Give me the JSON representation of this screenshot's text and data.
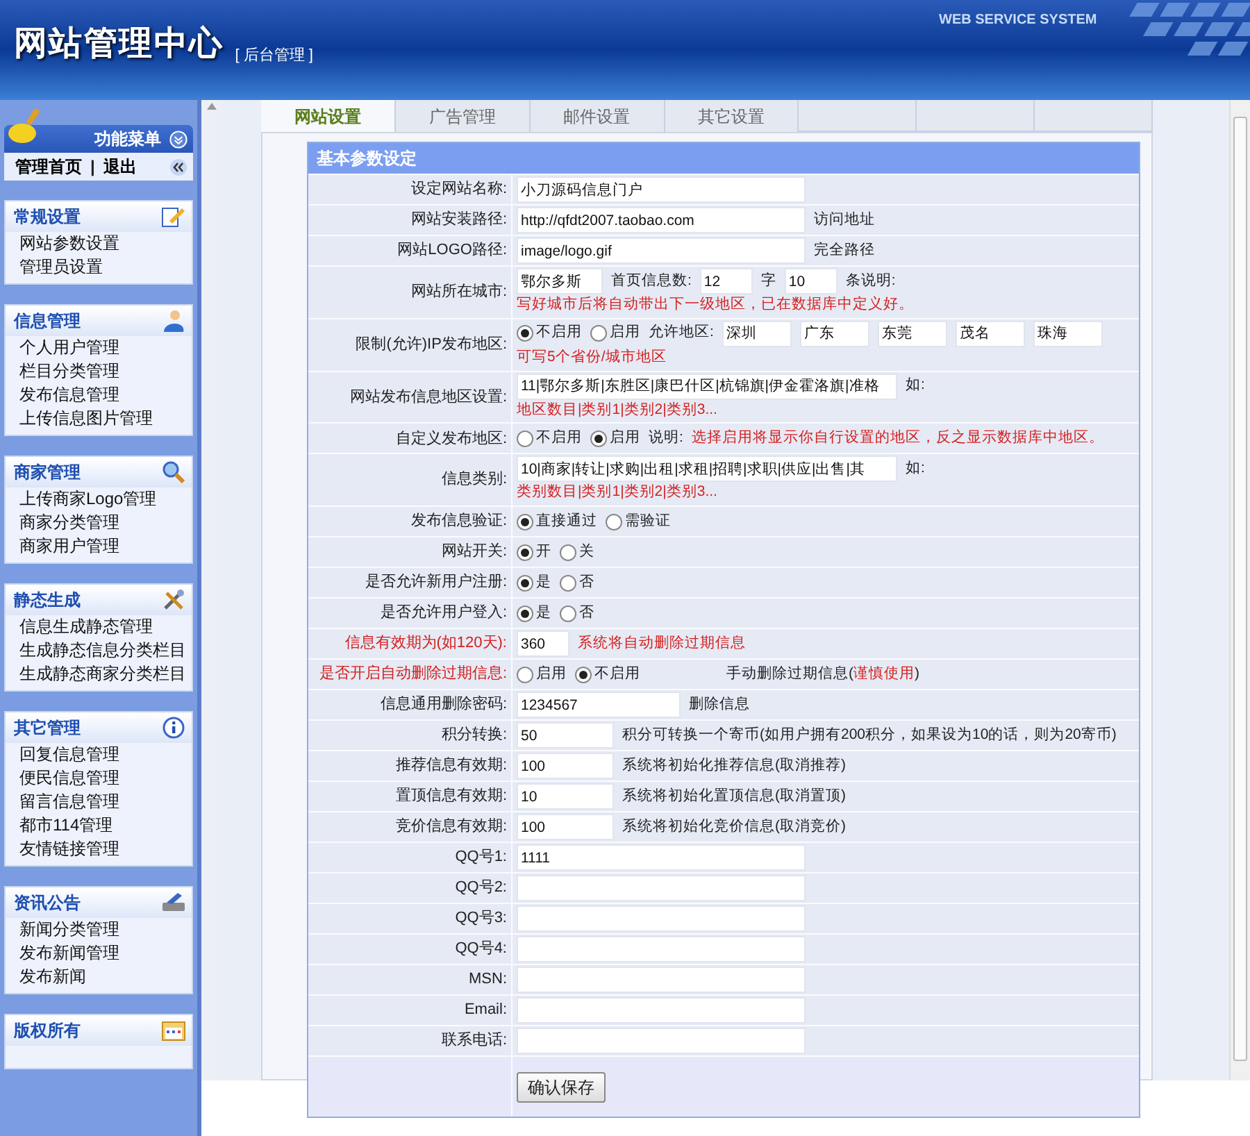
{
  "header": {
    "title": "网站管理中心",
    "subtitle": "[ 后台管理 ]",
    "tagline": "WEB SERVICE SYSTEM"
  },
  "sidebar": {
    "menu_title": "功能菜单",
    "home": "管理首页",
    "separator": "|",
    "logout": "退出",
    "sections": [
      {
        "title": "常规设置",
        "items": [
          "网站参数设置",
          "管理员设置"
        ]
      },
      {
        "title": "信息管理",
        "items": [
          "个人用户管理",
          "栏目分类管理",
          "发布信息管理",
          "上传信息图片管理"
        ]
      },
      {
        "title": "商家管理",
        "items": [
          "上传商家Logo管理",
          "商家分类管理",
          "商家用户管理"
        ]
      },
      {
        "title": "静态生成",
        "items": [
          "信息生成静态管理",
          "生成静态信息分类栏目",
          "生成静态商家分类栏目"
        ]
      },
      {
        "title": "其它管理",
        "items": [
          "回复信息管理",
          "便民信息管理",
          "留言信息管理",
          "都市114管理",
          "友情链接管理"
        ]
      },
      {
        "title": "资讯公告",
        "items": [
          "新闻分类管理",
          "发布新闻管理",
          "发布新闻"
        ]
      },
      {
        "title": "版权所有"
      }
    ]
  },
  "tabs": [
    {
      "label": "网站设置",
      "selected": true
    },
    {
      "label": "广告管理",
      "selected": false
    },
    {
      "label": "邮件设置",
      "selected": false
    },
    {
      "label": "其它设置",
      "selected": false
    }
  ],
  "form": {
    "title": "基本参数设定",
    "rows": [
      {
        "label": "设定网站名称:",
        "alert": false,
        "parts": [
          {
            "kind": "wide_field",
            "value": "小刀源码信息门户"
          }
        ]
      },
      {
        "label": "网站安装路径:",
        "alert": false,
        "parts": [
          {
            "kind": "wide_field",
            "value": "http://qfdt2007.taobao.com"
          },
          {
            "kind": "note",
            "text": "访问地址"
          }
        ]
      },
      {
        "label": "网站LOGO路径:",
        "alert": false,
        "parts": [
          {
            "kind": "wide_field",
            "value": "image/logo.gif"
          },
          {
            "kind": "note",
            "text": "完全路径"
          }
        ]
      },
      {
        "label": "网站所在城市:",
        "alert": false,
        "parts": [
          {
            "kind": "city_field",
            "value": "鄂尔多斯"
          },
          {
            "kind": "note",
            "text": "首页信息数:"
          },
          {
            "kind": "tiny_field",
            "value": "12"
          },
          {
            "kind": "note",
            "text": "字"
          },
          {
            "kind": "tiny_field",
            "value": "10"
          },
          {
            "kind": "note",
            "text": "条说明:"
          },
          {
            "kind": "warning",
            "text": "写好城市后将自动带出下一级地区，已在数据库中定义好。"
          }
        ]
      },
      {
        "label": "限制(允许)IP发布地区:",
        "alert": false,
        "parts": [
          {
            "kind": "radio",
            "text": "不启用",
            "selected": true
          },
          {
            "kind": "radio",
            "text": "启用",
            "selected": false
          },
          {
            "kind": "note",
            "text": "允许地区:"
          },
          {
            "kind": "small_field",
            "value": "深圳"
          },
          {
            "kind": "small_field",
            "value": "广东"
          },
          {
            "kind": "small_field",
            "value": "东莞"
          },
          {
            "kind": "small_field",
            "value": "茂名"
          },
          {
            "kind": "small_field",
            "value": "珠海"
          },
          {
            "kind": "warning",
            "text": "可写5个省份/城市地区"
          }
        ]
      },
      {
        "label": "网站发布信息地区设置:",
        "alert": false,
        "parts": [
          {
            "kind": "long_field",
            "value": "11|鄂尔多斯|东胜区|康巴什区|杭锦旗|伊金霍洛旗|准格"
          },
          {
            "kind": "note",
            "text": "如:"
          },
          {
            "kind": "warning",
            "text": "地区数目|类别1|类别2|类别3..."
          }
        ]
      },
      {
        "label": "自定义发布地区:",
        "alert": false,
        "parts": [
          {
            "kind": "radio",
            "text": "不启用",
            "selected": false
          },
          {
            "kind": "radio",
            "text": "启用",
            "selected": true
          },
          {
            "kind": "note",
            "text": "说明:"
          },
          {
            "kind": "warning",
            "text": "选择启用将显示你自行设置的地区，反之显示数据库中地区。"
          }
        ]
      },
      {
        "label": "信息类别:",
        "alert": false,
        "parts": [
          {
            "kind": "long_field",
            "value": "10|商家|转让|求购|出租|求租|招聘|求职|供应|出售|其"
          },
          {
            "kind": "note",
            "text": "如:"
          },
          {
            "kind": "warning",
            "text": "类别数目|类别1|类别2|类别3..."
          }
        ]
      },
      {
        "label": "发布信息验证:",
        "alert": false,
        "parts": [
          {
            "kind": "radio",
            "text": "直接通过",
            "selected": true
          },
          {
            "kind": "radio",
            "text": "需验证",
            "selected": false
          }
        ]
      },
      {
        "label": "网站开关:",
        "alert": false,
        "parts": [
          {
            "kind": "radio",
            "text": "开",
            "selected": true
          },
          {
            "kind": "radio",
            "text": "关",
            "selected": false
          }
        ]
      },
      {
        "label": "是否允许新用户注册:",
        "alert": false,
        "parts": [
          {
            "kind": "radio",
            "text": "是",
            "selected": true
          },
          {
            "kind": "radio",
            "text": "否",
            "selected": false
          }
        ]
      },
      {
        "label": "是否允许用户登入:",
        "alert": false,
        "parts": [
          {
            "kind": "radio",
            "text": "是",
            "selected": true
          },
          {
            "kind": "radio",
            "text": "否",
            "selected": false
          }
        ]
      },
      {
        "label": "信息有效期为(如120天):",
        "alert": true,
        "parts": [
          {
            "kind": "tiny_field",
            "value": "360"
          },
          {
            "kind": "warning",
            "text": "系统将自动删除过期信息"
          }
        ]
      },
      {
        "label": "是否开启自动删除过期信息:",
        "alert": true,
        "parts": [
          {
            "kind": "radio",
            "text": "启用",
            "selected": false
          },
          {
            "kind": "radio",
            "text": "不启用",
            "selected": true
          },
          {
            "kind": "spacer"
          },
          {
            "kind": "note",
            "text": "手动删除过期信息("
          },
          {
            "kind": "warning",
            "text": "谨慎使用"
          },
          {
            "kind": "note",
            "text": ")"
          }
        ]
      },
      {
        "label": "信息通用删除密码:",
        "alert": false,
        "parts": [
          {
            "kind": "mid_field",
            "value": "1234567"
          },
          {
            "kind": "note",
            "text": "删除信息"
          }
        ]
      },
      {
        "label": "积分转换:",
        "alert": false,
        "parts": [
          {
            "kind": "short_field",
            "value": "50"
          },
          {
            "kind": "note",
            "text": "积分可转换一个寄币(如用户拥有200积分，如果设为10的话，则为20寄币)"
          }
        ]
      },
      {
        "label": "推荐信息有效期:",
        "alert": false,
        "parts": [
          {
            "kind": "short_field",
            "value": "100"
          },
          {
            "kind": "note",
            "text": "系统将初始化推荐信息(取消推荐)"
          }
        ]
      },
      {
        "label": "置顶信息有效期:",
        "alert": false,
        "parts": [
          {
            "kind": "short_field",
            "value": "10"
          },
          {
            "kind": "note",
            "text": "系统将初始化置顶信息(取消置顶)"
          }
        ]
      },
      {
        "label": "竞价信息有效期:",
        "alert": false,
        "parts": [
          {
            "kind": "short_field",
            "value": "100"
          },
          {
            "kind": "note",
            "text": "系统将初始化竞价信息(取消竞价)"
          }
        ]
      },
      {
        "label": "QQ号1:",
        "alert": false,
        "parts": [
          {
            "kind": "wide_field",
            "value": "1111"
          }
        ]
      },
      {
        "label": "QQ号2:",
        "alert": false,
        "parts": [
          {
            "kind": "wide_field"
          }
        ]
      },
      {
        "label": "QQ号3:",
        "alert": false,
        "parts": [
          {
            "kind": "wide_field"
          }
        ]
      },
      {
        "label": "QQ号4:",
        "alert": false,
        "parts": [
          {
            "kind": "wide_field"
          }
        ]
      },
      {
        "label": "MSN:",
        "alert": false,
        "parts": [
          {
            "kind": "wide_field"
          }
        ]
      },
      {
        "label": "Email:",
        "alert": false,
        "parts": [
          {
            "kind": "wide_field"
          }
        ]
      },
      {
        "label": "联系电话:",
        "alert": false,
        "parts": [
          {
            "kind": "wide_field"
          }
        ]
      }
    ],
    "submit": "确认保存"
  }
}
